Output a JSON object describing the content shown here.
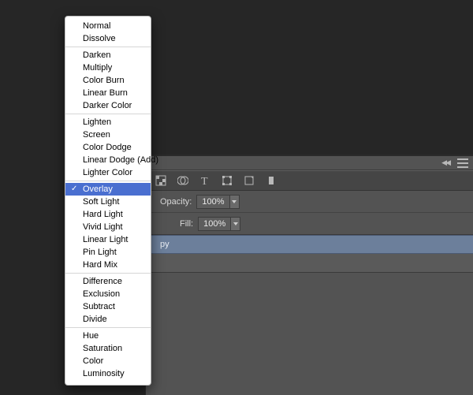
{
  "panel": {
    "collapse_tooltip": "Collapse",
    "menu_tooltip": "Panel Menu"
  },
  "toolbar": {
    "filter_icon": "filter-icon",
    "type_icon": "type-icon",
    "transform_icon": "transform-icon",
    "page_icon": "page-icon",
    "rect_icon": "rect-icon"
  },
  "controls": {
    "opacity_label": "Opacity:",
    "opacity_value": "100%",
    "fill_label": "Fill:",
    "fill_value": "100%"
  },
  "layers": {
    "selected_name": "py"
  },
  "blend_modes": {
    "selected": "Overlay",
    "groups": [
      [
        "Normal",
        "Dissolve"
      ],
      [
        "Darken",
        "Multiply",
        "Color Burn",
        "Linear Burn",
        "Darker Color"
      ],
      [
        "Lighten",
        "Screen",
        "Color Dodge",
        "Linear Dodge (Add)",
        "Lighter Color"
      ],
      [
        "Overlay",
        "Soft Light",
        "Hard Light",
        "Vivid Light",
        "Linear Light",
        "Pin Light",
        "Hard Mix"
      ],
      [
        "Difference",
        "Exclusion",
        "Subtract",
        "Divide"
      ],
      [
        "Hue",
        "Saturation",
        "Color",
        "Luminosity"
      ]
    ]
  }
}
